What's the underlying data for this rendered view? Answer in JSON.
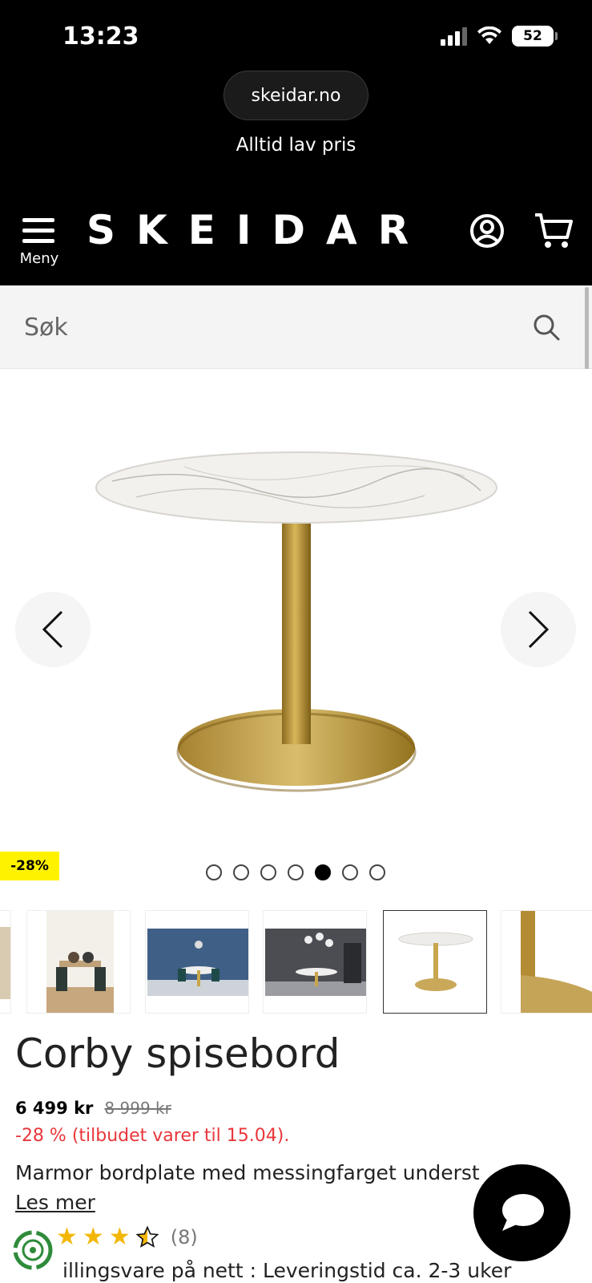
{
  "status_bar": {
    "time": "13:23",
    "battery": "52"
  },
  "browser": {
    "url": "skeidar.no"
  },
  "site": {
    "tagline": "Alltid lav pris",
    "logo": "SKEIDAR",
    "menu_label": "Meny"
  },
  "search": {
    "placeholder": "Søk"
  },
  "carousel": {
    "discount_badge": "-28%",
    "image_count": 7,
    "active_index": 4
  },
  "product": {
    "title": "Corby spisebord",
    "price": "6 499 kr",
    "old_price": "8 999 kr",
    "offer_text": "-28 % (tilbudet varer til 15.04).",
    "description": "Marmor bordplate med messingfarget underst",
    "read_more": "Les mer",
    "rating": 3.5,
    "review_count": "(8)",
    "delivery_text": "illingsvare på nett : Leveringstid ca. 2-3 uker"
  },
  "colors": {
    "accent_yellow": "#fff200",
    "offer_red": "#e8363b",
    "star": "#f2b705"
  }
}
